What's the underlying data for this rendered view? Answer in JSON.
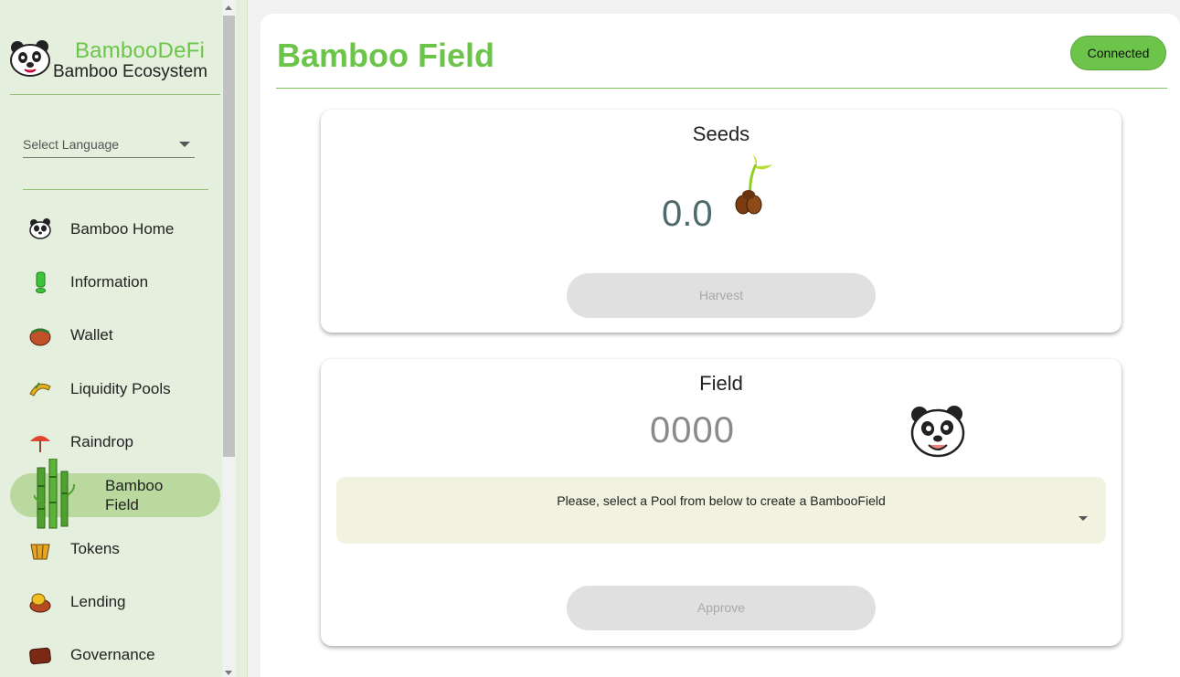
{
  "brand": {
    "title": "BambooDeFi",
    "subtitle": "Bamboo Ecosystem"
  },
  "language": {
    "label": "Select Language"
  },
  "nav": [
    {
      "label": "Bamboo Home",
      "icon": "panda-icon"
    },
    {
      "label": "Information",
      "icon": "info-icon"
    },
    {
      "label": "Wallet",
      "icon": "wallet-icon"
    },
    {
      "label": "Liquidity Pools",
      "icon": "pools-icon"
    },
    {
      "label": "Raindrop",
      "icon": "umbrella-icon"
    },
    {
      "label": "Bamboo Field",
      "icon": "bamboo-icon",
      "active": true
    },
    {
      "label": "Tokens",
      "icon": "tokens-icon"
    },
    {
      "label": "Lending",
      "icon": "lending-icon"
    },
    {
      "label": "Governance",
      "icon": "governance-icon"
    }
  ],
  "header": {
    "title": "Bamboo Field",
    "status": "Connected"
  },
  "seeds": {
    "title": "Seeds",
    "value": "0.0",
    "button": "Harvest"
  },
  "field": {
    "title": "Field",
    "value": "0000",
    "pool_select_placeholder": "Please, select a Pool from below to create a BambooField",
    "button": "Approve"
  },
  "colors": {
    "accent": "#6cc54a",
    "sidebar_bg": "#e5efdd",
    "active_bg": "#b9d99f",
    "select_bg": "#f1f2e0"
  }
}
